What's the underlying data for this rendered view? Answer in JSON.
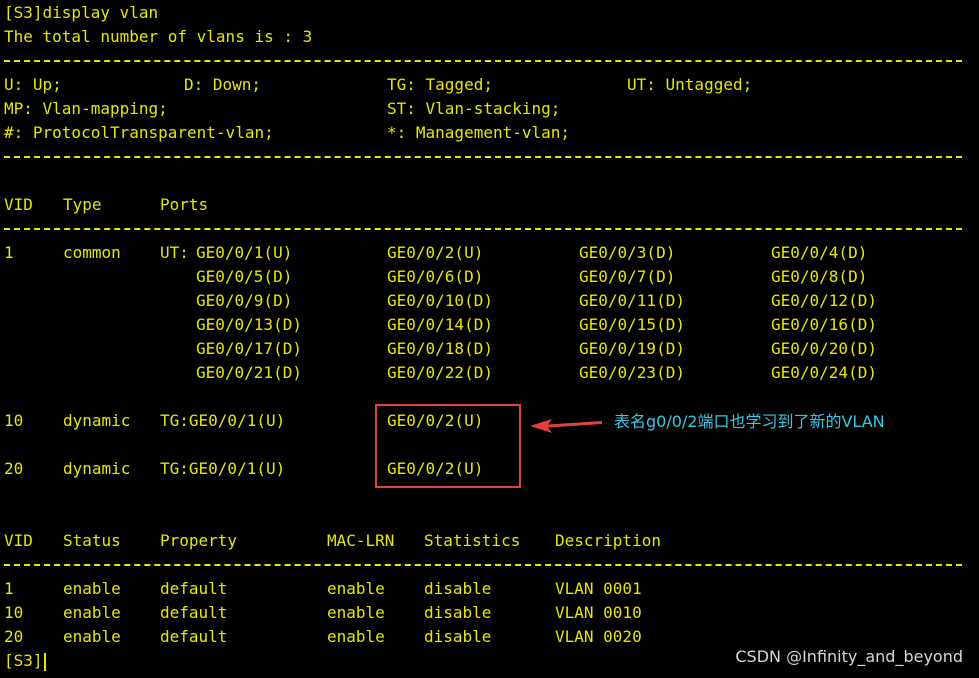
{
  "colors": {
    "background": "#000000",
    "text": "#e6e600",
    "annotation_box": "#e0433f",
    "annotation_text": "#36c8e6"
  },
  "command_line": "[S3]display vlan",
  "total_line": "The total number of vlans is : 3",
  "legend": {
    "up": "U: Up;",
    "down": "D: Down;",
    "tagged": "TG: Tagged;",
    "untagged": "UT: Untagged;",
    "mapping": "MP: Vlan-mapping;",
    "stacking": "ST: Vlan-stacking;",
    "protocol": "#: ProtocolTransparent-vlan;",
    "management": "*: Management-vlan;"
  },
  "ports_table": {
    "headers": [
      "VID",
      "Type",
      "Ports"
    ],
    "vlan1": {
      "vid": "1",
      "type": "common",
      "prefix": "UT:",
      "rows": [
        [
          "GE0/0/1(U)",
          "GE0/0/2(U)",
          "GE0/0/3(D)",
          "GE0/0/4(D)"
        ],
        [
          "GE0/0/5(D)",
          "GE0/0/6(D)",
          "GE0/0/7(D)",
          "GE0/0/8(D)"
        ],
        [
          "GE0/0/9(D)",
          "GE0/0/10(D)",
          "GE0/0/11(D)",
          "GE0/0/12(D)"
        ],
        [
          "GE0/0/13(D)",
          "GE0/0/14(D)",
          "GE0/0/15(D)",
          "GE0/0/16(D)"
        ],
        [
          "GE0/0/17(D)",
          "GE0/0/18(D)",
          "GE0/0/19(D)",
          "GE0/0/20(D)"
        ],
        [
          "GE0/0/21(D)",
          "GE0/0/22(D)",
          "GE0/0/23(D)",
          "GE0/0/24(D)"
        ]
      ]
    },
    "vlan10": {
      "vid": "10",
      "type": "dynamic",
      "ports": [
        "TG:GE0/0/1(U)",
        "GE0/0/2(U)"
      ]
    },
    "vlan20": {
      "vid": "20",
      "type": "dynamic",
      "ports": [
        "TG:GE0/0/1(U)",
        "GE0/0/2(U)"
      ]
    }
  },
  "status_table": {
    "headers": [
      "VID",
      "Status",
      "Property",
      "MAC-LRN",
      "Statistics",
      "Description"
    ],
    "rows": [
      [
        "1",
        "enable",
        "default",
        "enable",
        "disable",
        "VLAN 0001"
      ],
      [
        "10",
        "enable",
        "default",
        "enable",
        "disable",
        "VLAN 0010"
      ],
      [
        "20",
        "enable",
        "default",
        "enable",
        "disable",
        "VLAN 0020"
      ]
    ]
  },
  "prompt": "[S3]",
  "annotation_text": "表名g0/0/2端口也学习到了新的VLAN",
  "watermark": "CSDN @Infinity_and_beyond"
}
